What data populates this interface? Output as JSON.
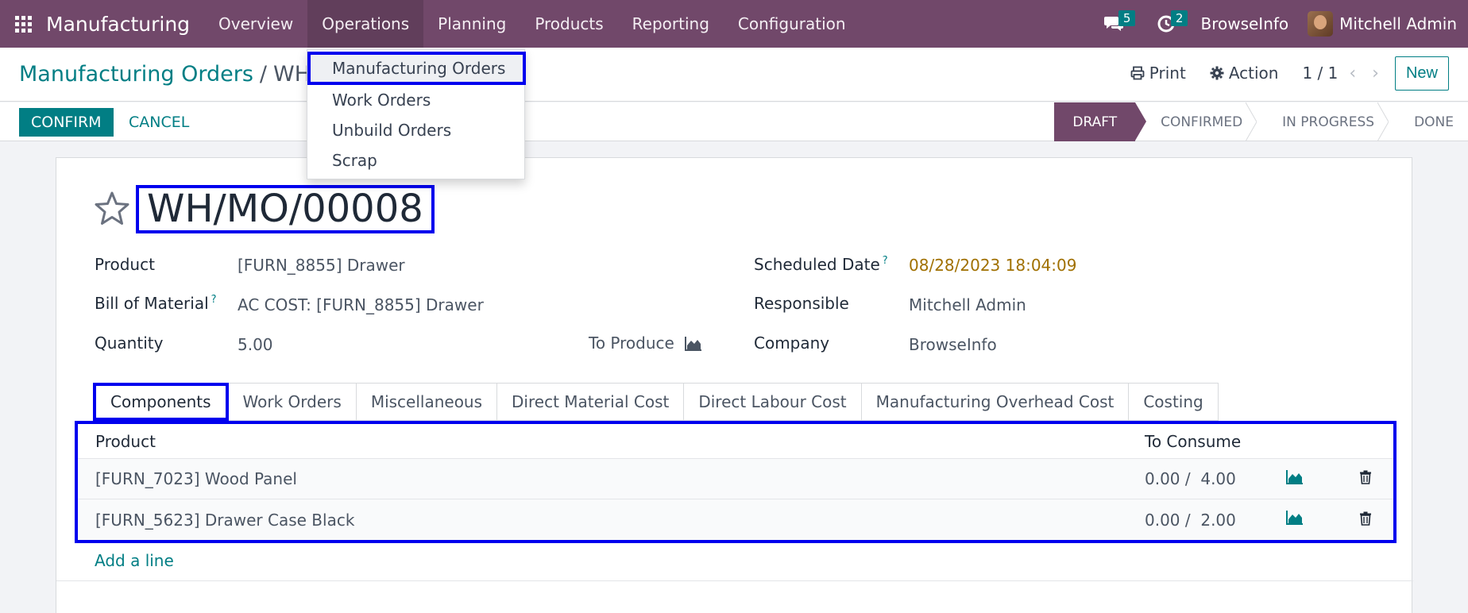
{
  "navbar": {
    "app_name": "Manufacturing",
    "menu": [
      "Overview",
      "Operations",
      "Planning",
      "Products",
      "Reporting",
      "Configuration"
    ],
    "messages_count": "5",
    "activities_count": "2",
    "company": "BrowseInfo",
    "user": "Mitchell Admin"
  },
  "breadcrumb": {
    "parent": "Manufacturing Orders",
    "separator": "/",
    "current": "WH"
  },
  "control": {
    "print_label": "Print",
    "action_label": "Action",
    "pager": "1 / 1",
    "new_label": "New"
  },
  "statusbar": {
    "confirm_label": "CONFIRM",
    "cancel_label": "CANCEL",
    "stages": [
      "DRAFT",
      "CONFIRMED",
      "IN PROGRESS",
      "DONE"
    ],
    "current_stage": "DRAFT"
  },
  "dropdown": {
    "items": [
      "Manufacturing Orders",
      "Work Orders",
      "Unbuild Orders",
      "Scrap"
    ]
  },
  "record": {
    "name": "WH/MO/00008",
    "product_label": "Product",
    "product": "[FURN_8855] Drawer",
    "bom_label": "Bill of Material",
    "bom": "AC COST: [FURN_8855] Drawer",
    "quantity_label": "Quantity",
    "quantity": "5.00",
    "to_produce_label": "To Produce",
    "scheduled_label": "Scheduled Date",
    "scheduled": "08/28/2023 18:04:09",
    "responsible_label": "Responsible",
    "responsible": "Mitchell Admin",
    "company_label": "Company",
    "company": "BrowseInfo",
    "help_marker": "?"
  },
  "tabs": [
    "Components",
    "Work Orders",
    "Miscellaneous",
    "Direct Material Cost",
    "Direct Labour Cost",
    "Manufacturing Overhead Cost",
    "Costing"
  ],
  "components": {
    "col_product": "Product",
    "col_consume": "To Consume",
    "rows": [
      {
        "product": "[FURN_7023] Wood Panel",
        "consumed": "0.00",
        "to_consume": "4.00"
      },
      {
        "product": "[FURN_5623] Drawer Case Black",
        "consumed": "0.00",
        "to_consume": "2.00"
      }
    ],
    "add_line": "Add a line"
  },
  "colors": {
    "navbar": "#71486a",
    "accent": "#017e84",
    "highlight_box": "#0000ee",
    "date": "#a07000"
  }
}
